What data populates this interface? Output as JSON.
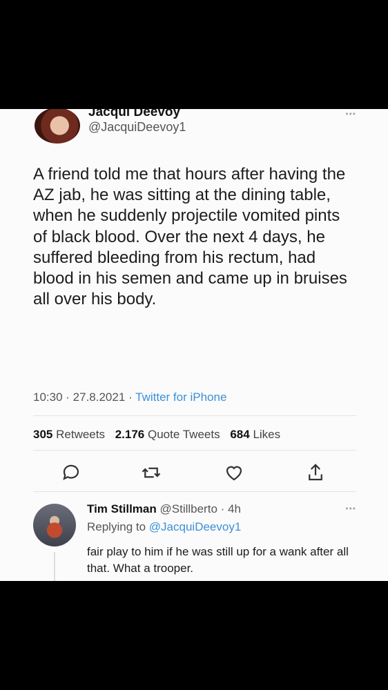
{
  "tweet": {
    "author_name": "Jacqui Deevoy",
    "author_handle": "@JacquiDeevoy1",
    "text": "A friend told me that hours after having the AZ jab, he was sitting at the dining table, when he suddenly projectile vomited pints of black blood. Over the next 4 days, he suffered bleeding from his rectum, had blood in his semen and came up in bruises all over his body.",
    "time": "10:30",
    "date": "27.8.2021",
    "source": "Twitter for iPhone",
    "more": "•••",
    "stats": {
      "retweets_count": "305",
      "retweets_label": "Retweets",
      "quotes_count": "2.176",
      "quotes_label": "Quote Tweets",
      "likes_count": "684",
      "likes_label": "Likes"
    },
    "actions": [
      "reply-icon",
      "retweet-icon",
      "like-icon",
      "share-icon"
    ]
  },
  "reply": {
    "author_name": "Tim Stillman",
    "author_handle": "@Stillberto",
    "age": "4h",
    "replying_to_label": "Replying to",
    "replying_to_handle": "@JacquiDeevoy1",
    "text": "fair play to him if he was still up for a wank after all that. What a trooper.",
    "more": "•••"
  },
  "colors": {
    "link": "#3b8fd8",
    "text": "#1c1c1c",
    "muted": "#555555"
  }
}
